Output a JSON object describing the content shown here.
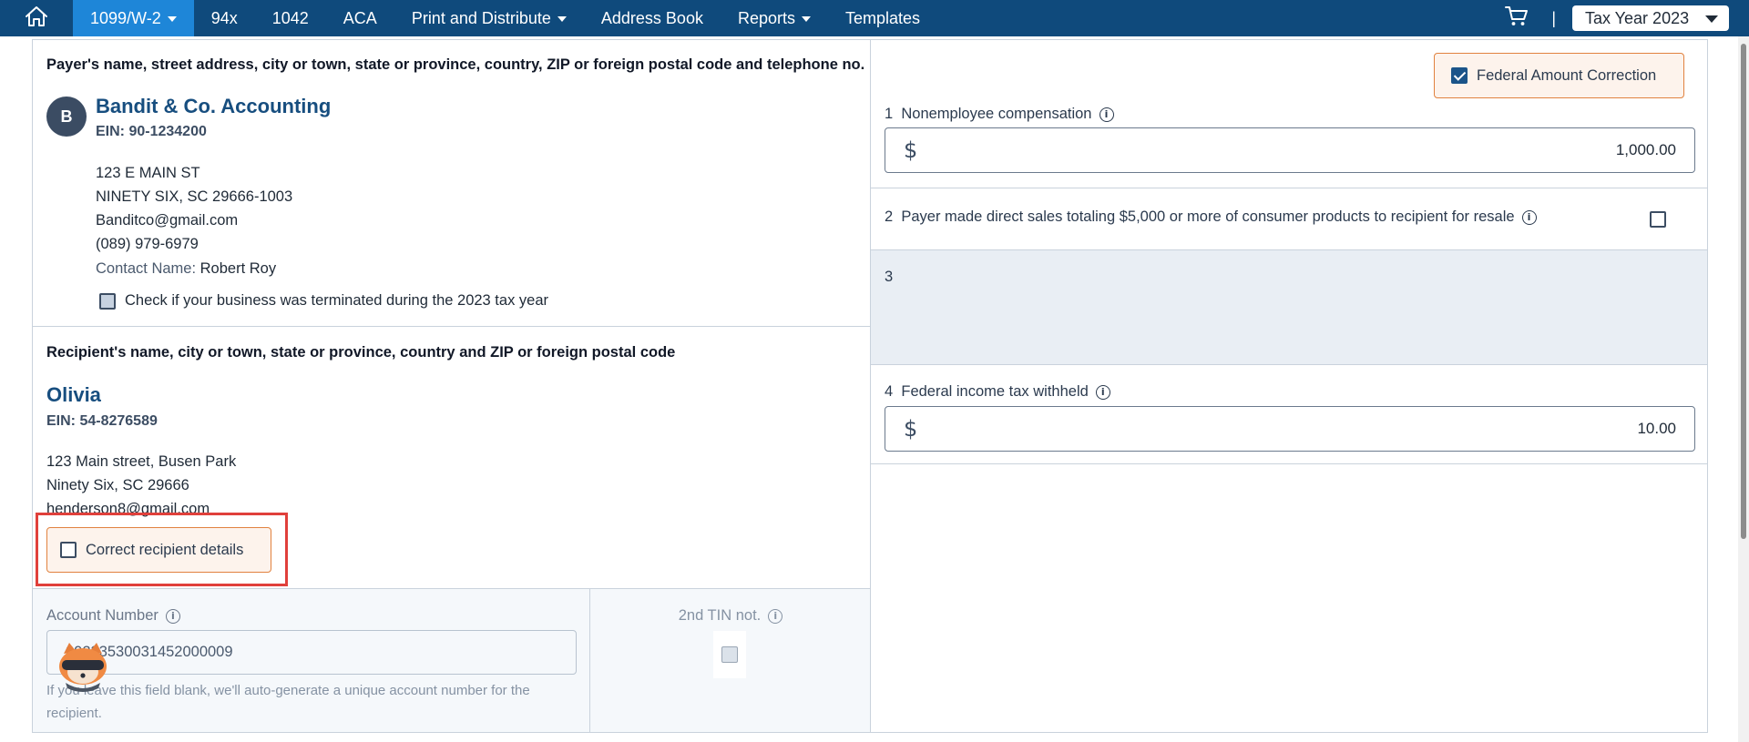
{
  "nav": {
    "items": [
      {
        "label": "1099/W-2",
        "active": true,
        "dropdown": true
      },
      {
        "label": "94x"
      },
      {
        "label": "1042"
      },
      {
        "label": "ACA"
      },
      {
        "label": "Print and Distribute",
        "dropdown": true
      },
      {
        "label": "Address Book"
      },
      {
        "label": "Reports",
        "dropdown": true
      },
      {
        "label": "Templates"
      }
    ],
    "separator": "|",
    "tax_year": "Tax Year 2023",
    "icons": {
      "home": "home-icon",
      "cart": "cart-icon"
    }
  },
  "payer": {
    "section_label": "Payer's name, street address, city or town, state or province, country, ZIP or foreign postal code and telephone no.",
    "avatar_letter": "B",
    "name": "Bandit & Co. Accounting",
    "ein": "EIN: 90-1234200",
    "address_line1": "123 E MAIN ST",
    "address_line2": "NINETY SIX, SC 29666-1003",
    "email": "Banditco@gmail.com",
    "phone": "(089) 979-6979",
    "contact_label": "Contact Name:",
    "contact_name": "Robert Roy",
    "terminated_label": "Check if your business was terminated during the 2023 tax year"
  },
  "recipient": {
    "section_label": "Recipient's name, city or town, state or province, country and ZIP or foreign postal code",
    "name": "Olivia",
    "ein": "EIN: 54-8276589",
    "address_line1": "123 Main street, Busen Park",
    "address_line2": "Ninety Six, SC 29666",
    "email": "henderson8@gmail.com",
    "correct_label": "Correct recipient details"
  },
  "account": {
    "label": "Account Number",
    "value": "20233530031452000009",
    "help": "If you leave this field blank, we'll auto-generate a unique account number for the recipient."
  },
  "tin": {
    "label": "2nd TIN not."
  },
  "federal_correction": {
    "label": "Federal Amount Correction",
    "checked": true
  },
  "boxes": {
    "box1": {
      "num": "1",
      "label": "Nonemployee compensation",
      "currency": "$",
      "value": "1,000.00"
    },
    "box2": {
      "num": "2",
      "label": "Payer made direct sales totaling $5,000 or more of consumer products to recipient for resale"
    },
    "box3": {
      "num": "3"
    },
    "box4": {
      "num": "4",
      "label": "Federal income tax withheld",
      "currency": "$",
      "value": "10.00"
    }
  },
  "colors": {
    "nav_bg": "#0f4a7c",
    "nav_active": "#1e86d8",
    "name_blue": "#174e7f",
    "highlight_red": "#e0403b",
    "correction_orange": "#e1823f"
  }
}
